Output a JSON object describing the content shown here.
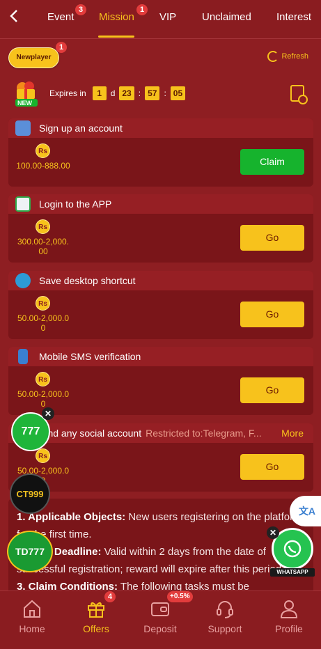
{
  "header": {
    "back_icon": "chevron-left-icon",
    "tabs": [
      {
        "label": "Event",
        "badge": "3"
      },
      {
        "label": "Mission",
        "badge": "1",
        "active": true
      },
      {
        "label": "VIP"
      },
      {
        "label": "Unclaimed"
      },
      {
        "label": "Interest"
      }
    ]
  },
  "newplayer": {
    "label": "Newplayer",
    "badge": "1"
  },
  "refresh": {
    "label": "Refresh"
  },
  "expires": {
    "gift_badge": "NEW",
    "label": "Expires in",
    "days": "1",
    "day_unit": "d",
    "hours": "23",
    "minutes": "57",
    "seconds": "05",
    "separator": ":"
  },
  "currency_symbol": "Rs",
  "tasks": [
    {
      "title": "Sign up an account",
      "amount": "100.00-888.00",
      "button": "Claim",
      "icon": "clipboard-icon"
    },
    {
      "title": "Login to the APP",
      "amount": "300.00-2,000.00",
      "button": "Go",
      "icon": "login-icon"
    },
    {
      "title": "Save desktop shortcut",
      "amount": "50.00-2,000.00",
      "button": "Go",
      "icon": "globe-icon"
    },
    {
      "title": "Mobile SMS verification",
      "amount": "50.00-2,000.00",
      "button": "Go",
      "icon": "phone-icon"
    },
    {
      "title": "Bind any social account",
      "restriction": "Restricted to:Telegram, F...",
      "more": "More",
      "amount": "50.00-2,000.00",
      "button": "Go",
      "icon": "social-icon"
    }
  ],
  "rules": {
    "item1_title": "1. Applicable Objects:",
    "item1_text": " New users registering on the platform for the first time.",
    "item2_title": "2. Task Deadline:",
    "item2_text": " Valid within 2 days from the date of successful registration; reward will expire after this period.",
    "item3_title": "3. Claim Conditions:",
    "item3_text": " The following tasks must be"
  },
  "floating": {
    "f777": "777",
    "ct999": "CT999",
    "td777": "TD777",
    "whatsapp": "WHATSAPP",
    "close": "✕",
    "translate": "文A"
  },
  "bottom_nav": [
    {
      "label": "Home",
      "icon": "home-icon"
    },
    {
      "label": "Offers",
      "icon": "gift-icon",
      "badge": "4",
      "active": true
    },
    {
      "label": "Deposit",
      "icon": "wallet-icon",
      "badge": "+0.5%"
    },
    {
      "label": "Support",
      "icon": "headset-icon"
    },
    {
      "label": "Profile",
      "icon": "user-icon"
    }
  ],
  "colors": {
    "background": "#8e1e22",
    "accent": "#f7c21c",
    "claim": "#16b32d"
  }
}
